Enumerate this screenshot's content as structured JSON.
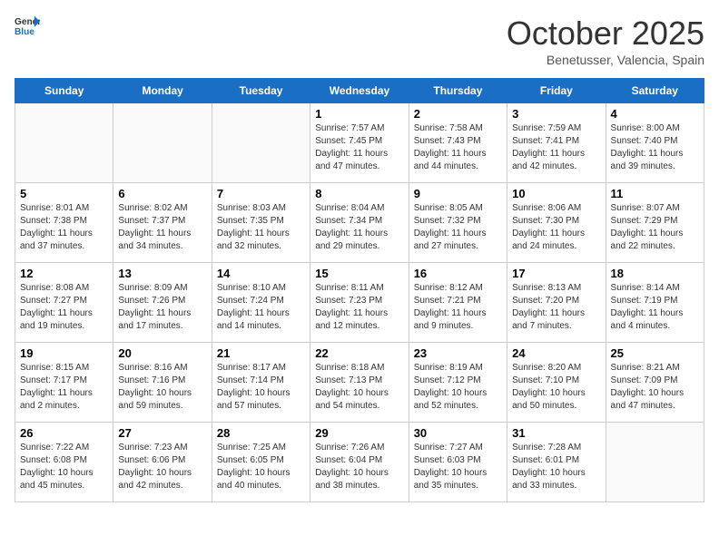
{
  "header": {
    "logo_general": "General",
    "logo_blue": "Blue",
    "month_title": "October 2025",
    "location": "Benetusser, Valencia, Spain"
  },
  "days_of_week": [
    "Sunday",
    "Monday",
    "Tuesday",
    "Wednesday",
    "Thursday",
    "Friday",
    "Saturday"
  ],
  "weeks": [
    [
      {
        "day": "",
        "info": ""
      },
      {
        "day": "",
        "info": ""
      },
      {
        "day": "",
        "info": ""
      },
      {
        "day": "1",
        "info": "Sunrise: 7:57 AM\nSunset: 7:45 PM\nDaylight: 11 hours\nand 47 minutes."
      },
      {
        "day": "2",
        "info": "Sunrise: 7:58 AM\nSunset: 7:43 PM\nDaylight: 11 hours\nand 44 minutes."
      },
      {
        "day": "3",
        "info": "Sunrise: 7:59 AM\nSunset: 7:41 PM\nDaylight: 11 hours\nand 42 minutes."
      },
      {
        "day": "4",
        "info": "Sunrise: 8:00 AM\nSunset: 7:40 PM\nDaylight: 11 hours\nand 39 minutes."
      }
    ],
    [
      {
        "day": "5",
        "info": "Sunrise: 8:01 AM\nSunset: 7:38 PM\nDaylight: 11 hours\nand 37 minutes."
      },
      {
        "day": "6",
        "info": "Sunrise: 8:02 AM\nSunset: 7:37 PM\nDaylight: 11 hours\nand 34 minutes."
      },
      {
        "day": "7",
        "info": "Sunrise: 8:03 AM\nSunset: 7:35 PM\nDaylight: 11 hours\nand 32 minutes."
      },
      {
        "day": "8",
        "info": "Sunrise: 8:04 AM\nSunset: 7:34 PM\nDaylight: 11 hours\nand 29 minutes."
      },
      {
        "day": "9",
        "info": "Sunrise: 8:05 AM\nSunset: 7:32 PM\nDaylight: 11 hours\nand 27 minutes."
      },
      {
        "day": "10",
        "info": "Sunrise: 8:06 AM\nSunset: 7:30 PM\nDaylight: 11 hours\nand 24 minutes."
      },
      {
        "day": "11",
        "info": "Sunrise: 8:07 AM\nSunset: 7:29 PM\nDaylight: 11 hours\nand 22 minutes."
      }
    ],
    [
      {
        "day": "12",
        "info": "Sunrise: 8:08 AM\nSunset: 7:27 PM\nDaylight: 11 hours\nand 19 minutes."
      },
      {
        "day": "13",
        "info": "Sunrise: 8:09 AM\nSunset: 7:26 PM\nDaylight: 11 hours\nand 17 minutes."
      },
      {
        "day": "14",
        "info": "Sunrise: 8:10 AM\nSunset: 7:24 PM\nDaylight: 11 hours\nand 14 minutes."
      },
      {
        "day": "15",
        "info": "Sunrise: 8:11 AM\nSunset: 7:23 PM\nDaylight: 11 hours\nand 12 minutes."
      },
      {
        "day": "16",
        "info": "Sunrise: 8:12 AM\nSunset: 7:21 PM\nDaylight: 11 hours\nand 9 minutes."
      },
      {
        "day": "17",
        "info": "Sunrise: 8:13 AM\nSunset: 7:20 PM\nDaylight: 11 hours\nand 7 minutes."
      },
      {
        "day": "18",
        "info": "Sunrise: 8:14 AM\nSunset: 7:19 PM\nDaylight: 11 hours\nand 4 minutes."
      }
    ],
    [
      {
        "day": "19",
        "info": "Sunrise: 8:15 AM\nSunset: 7:17 PM\nDaylight: 11 hours\nand 2 minutes."
      },
      {
        "day": "20",
        "info": "Sunrise: 8:16 AM\nSunset: 7:16 PM\nDaylight: 10 hours\nand 59 minutes."
      },
      {
        "day": "21",
        "info": "Sunrise: 8:17 AM\nSunset: 7:14 PM\nDaylight: 10 hours\nand 57 minutes."
      },
      {
        "day": "22",
        "info": "Sunrise: 8:18 AM\nSunset: 7:13 PM\nDaylight: 10 hours\nand 54 minutes."
      },
      {
        "day": "23",
        "info": "Sunrise: 8:19 AM\nSunset: 7:12 PM\nDaylight: 10 hours\nand 52 minutes."
      },
      {
        "day": "24",
        "info": "Sunrise: 8:20 AM\nSunset: 7:10 PM\nDaylight: 10 hours\nand 50 minutes."
      },
      {
        "day": "25",
        "info": "Sunrise: 8:21 AM\nSunset: 7:09 PM\nDaylight: 10 hours\nand 47 minutes."
      }
    ],
    [
      {
        "day": "26",
        "info": "Sunrise: 7:22 AM\nSunset: 6:08 PM\nDaylight: 10 hours\nand 45 minutes."
      },
      {
        "day": "27",
        "info": "Sunrise: 7:23 AM\nSunset: 6:06 PM\nDaylight: 10 hours\nand 42 minutes."
      },
      {
        "day": "28",
        "info": "Sunrise: 7:25 AM\nSunset: 6:05 PM\nDaylight: 10 hours\nand 40 minutes."
      },
      {
        "day": "29",
        "info": "Sunrise: 7:26 AM\nSunset: 6:04 PM\nDaylight: 10 hours\nand 38 minutes."
      },
      {
        "day": "30",
        "info": "Sunrise: 7:27 AM\nSunset: 6:03 PM\nDaylight: 10 hours\nand 35 minutes."
      },
      {
        "day": "31",
        "info": "Sunrise: 7:28 AM\nSunset: 6:01 PM\nDaylight: 10 hours\nand 33 minutes."
      },
      {
        "day": "",
        "info": ""
      }
    ]
  ]
}
